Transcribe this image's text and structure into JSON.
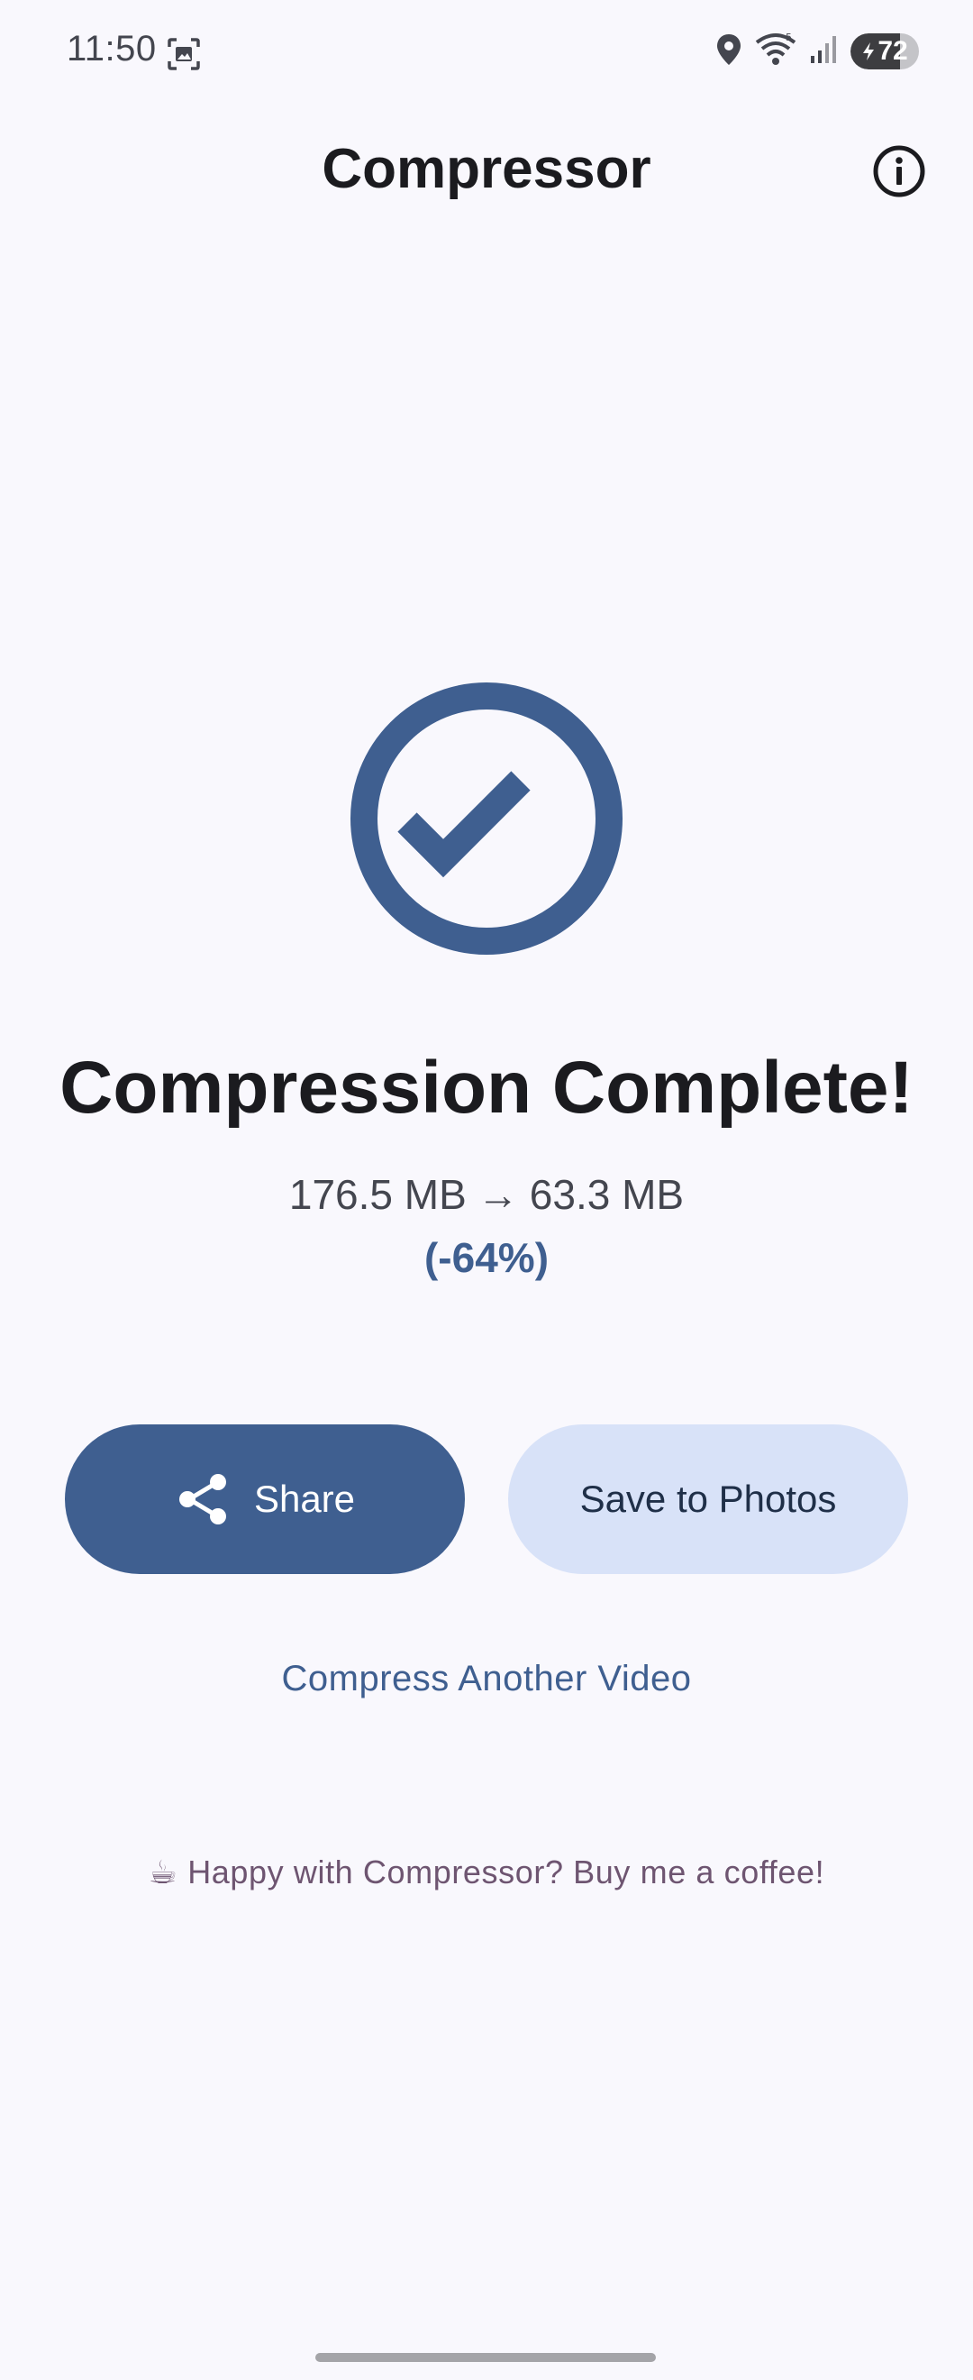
{
  "status_bar": {
    "time": "11:50",
    "battery": "72",
    "battery_level": 0.72,
    "icons": [
      "screenshot-icon",
      "location-icon",
      "wifi-icon",
      "signal-icon",
      "battery-icon"
    ]
  },
  "app_bar": {
    "title": "Compressor",
    "info_icon": "info-icon"
  },
  "result": {
    "icon": "check-circle-icon",
    "heading": "Compression Complete!",
    "original_size": "176.5 MB",
    "arrow": "→",
    "compressed_size": "63.3 MB",
    "percent_change": "(-64%)"
  },
  "actions": {
    "share_label": "Share",
    "share_icon": "share-icon",
    "save_label": "Save to Photos",
    "compress_another_label": "Compress Another Video"
  },
  "footer": {
    "coffee_text": "☕ Happy with Compressor? Buy me a coffee!"
  },
  "colors": {
    "background": "#f9f8fd",
    "primary": "#3f5f90",
    "primary_container": "#d8e2f8",
    "on_surface": "#1b1b1f",
    "tertiary": "#6e5571"
  }
}
